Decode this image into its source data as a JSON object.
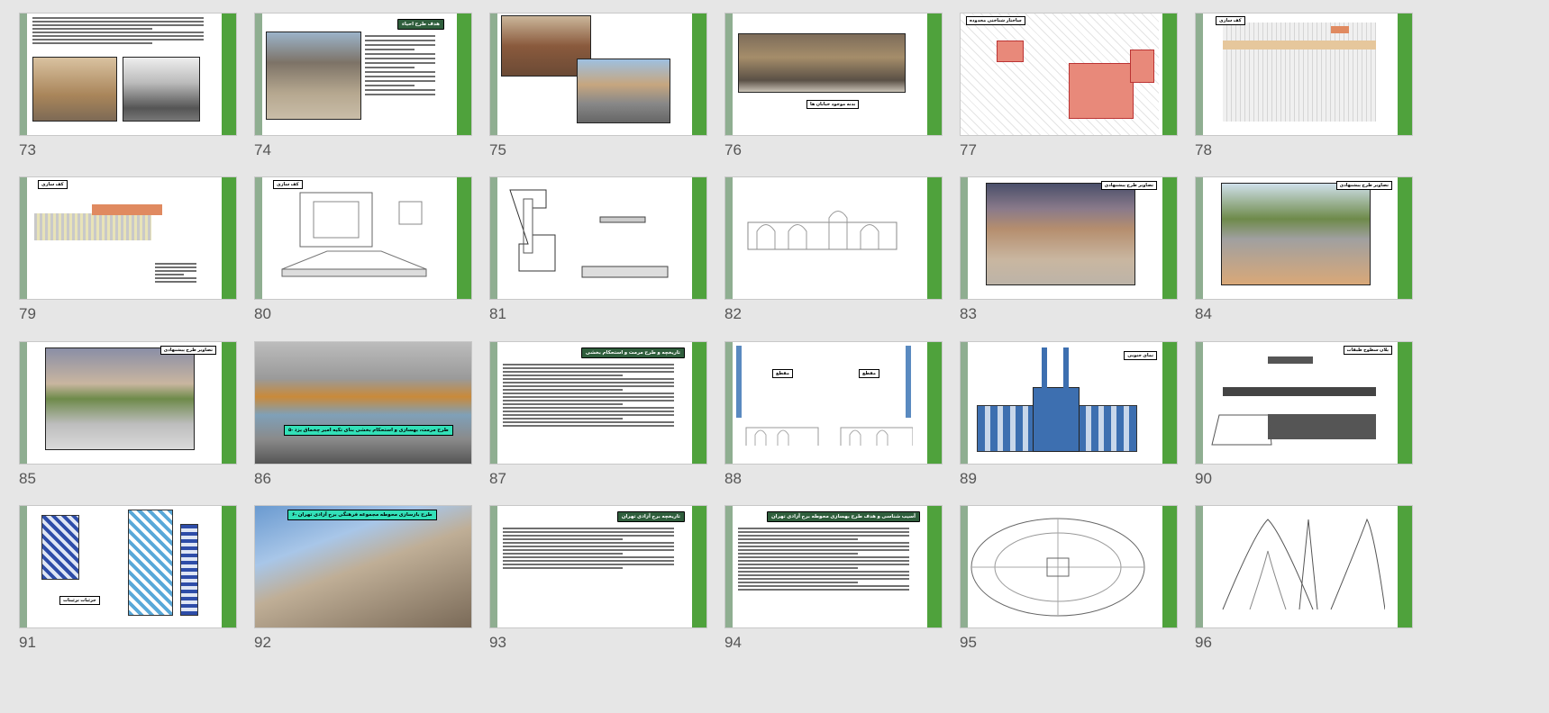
{
  "colors": {
    "background": "#e6e6e6",
    "green_bar": "#4fa23c",
    "sage_bar": "#8fae91",
    "dark_title": "#2f5e3c",
    "cyan_title": "#33e0b8"
  },
  "slides": [
    {
      "number": "73",
      "title": "",
      "type": "text-photos"
    },
    {
      "number": "74",
      "title": "هدف طرح احیاء",
      "type": "photo-text"
    },
    {
      "number": "75",
      "title": "",
      "type": "two-photos"
    },
    {
      "number": "76",
      "title": "بدنه موجود خیابان ها",
      "type": "street"
    },
    {
      "number": "77",
      "title": "ساختار شناختی محدوده",
      "type": "map"
    },
    {
      "number": "78",
      "title": "کف سازی",
      "type": "plan"
    },
    {
      "number": "79",
      "title": "کف سازی",
      "type": "plan2"
    },
    {
      "number": "80",
      "title": "کف سازی",
      "type": "detail"
    },
    {
      "number": "81",
      "title": "",
      "type": "drawings"
    },
    {
      "number": "82",
      "title": "",
      "type": "elevation"
    },
    {
      "number": "83",
      "title": "تصاویر طرح پیشنهادی",
      "type": "render"
    },
    {
      "number": "84",
      "title": "تصاویر طرح پیشنهادی",
      "type": "render2"
    },
    {
      "number": "85",
      "title": "تصاویر طرح پیشنهادی",
      "type": "render3"
    },
    {
      "number": "86",
      "title": "۵- طرح مرمت، بهسازی و استحکام بخشی بنای تکیه امیر چخماق یزد",
      "type": "fullphoto"
    },
    {
      "number": "87",
      "title": "تاریخچه و طرح مرمت و استحکام بخشی",
      "type": "text"
    },
    {
      "number": "88",
      "title": "مقطع",
      "title2": "مقطع",
      "type": "section"
    },
    {
      "number": "89",
      "title": "نمای جنوبی",
      "type": "facade"
    },
    {
      "number": "90",
      "title": "پلان سطوح طبقات",
      "type": "floorplans"
    },
    {
      "number": "91",
      "title": "جزئیات تزئینات",
      "type": "ornaments"
    },
    {
      "number": "92",
      "title": "۶- طرح بازسازی محوطه مجموعه فرهنگی برج آزادی تهران",
      "type": "azadi"
    },
    {
      "number": "93",
      "title": "تاریخچه برج آزادی تهران",
      "type": "text2"
    },
    {
      "number": "94",
      "title": "آسیب شناسی و هدف طرح بهسازی محوطه برج آزادی تهران",
      "type": "text3"
    },
    {
      "number": "95",
      "title": "",
      "type": "siteplan"
    },
    {
      "number": "96",
      "title": "",
      "type": "towerdrawings"
    }
  ]
}
